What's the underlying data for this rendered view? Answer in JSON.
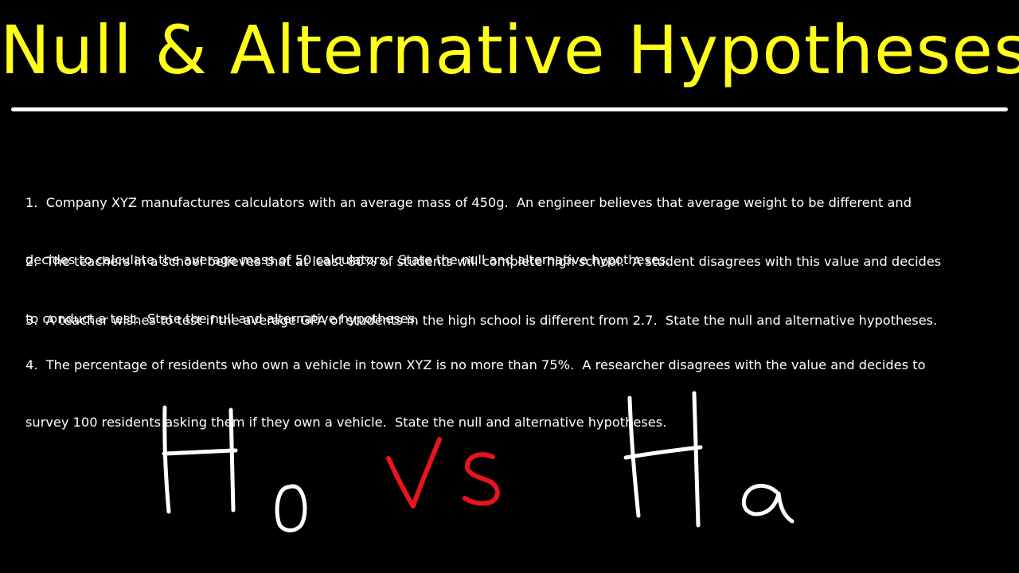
{
  "title": "Null & Alternative Hypotheses",
  "colors": {
    "background": "#000000",
    "title": "#ffff1a",
    "body_text": "#ffffff",
    "rule": "#ffffff",
    "handwriting_main": "#ffffff",
    "handwriting_vs": "#e8141c"
  },
  "problems": [
    {
      "lines": [
        "1.  Company XYZ manufactures calculators with an average mass of 450g.  An engineer believes that average weight to be different and",
        "decides to calculate the average mass of 50 calculators.  State the null and alternative hypotheses."
      ]
    },
    {
      "lines": [
        "2.  The teachers in a school believes that at least 80% of students will complete high school.  A student disagrees with this value and decides",
        "to conduct a test.  State the null and alternative hypotheses."
      ]
    },
    {
      "lines": [
        "3.  A teacher wishes to test if the average GPA of students in the high school is different from 2.7.  State the null and alternative hypotheses."
      ]
    },
    {
      "lines": [
        "4.  The percentage of residents who own a vehicle in town XYZ is no more than 75%.  A researcher disagrees with the value and decides to",
        "survey 100 residents asking them if they own a vehicle.  State the null and alternative hypotheses."
      ]
    }
  ],
  "handwriting": {
    "left_letter": "H",
    "left_subscript": "0",
    "middle": "vs",
    "right_letter": "H",
    "right_subscript": "a"
  }
}
